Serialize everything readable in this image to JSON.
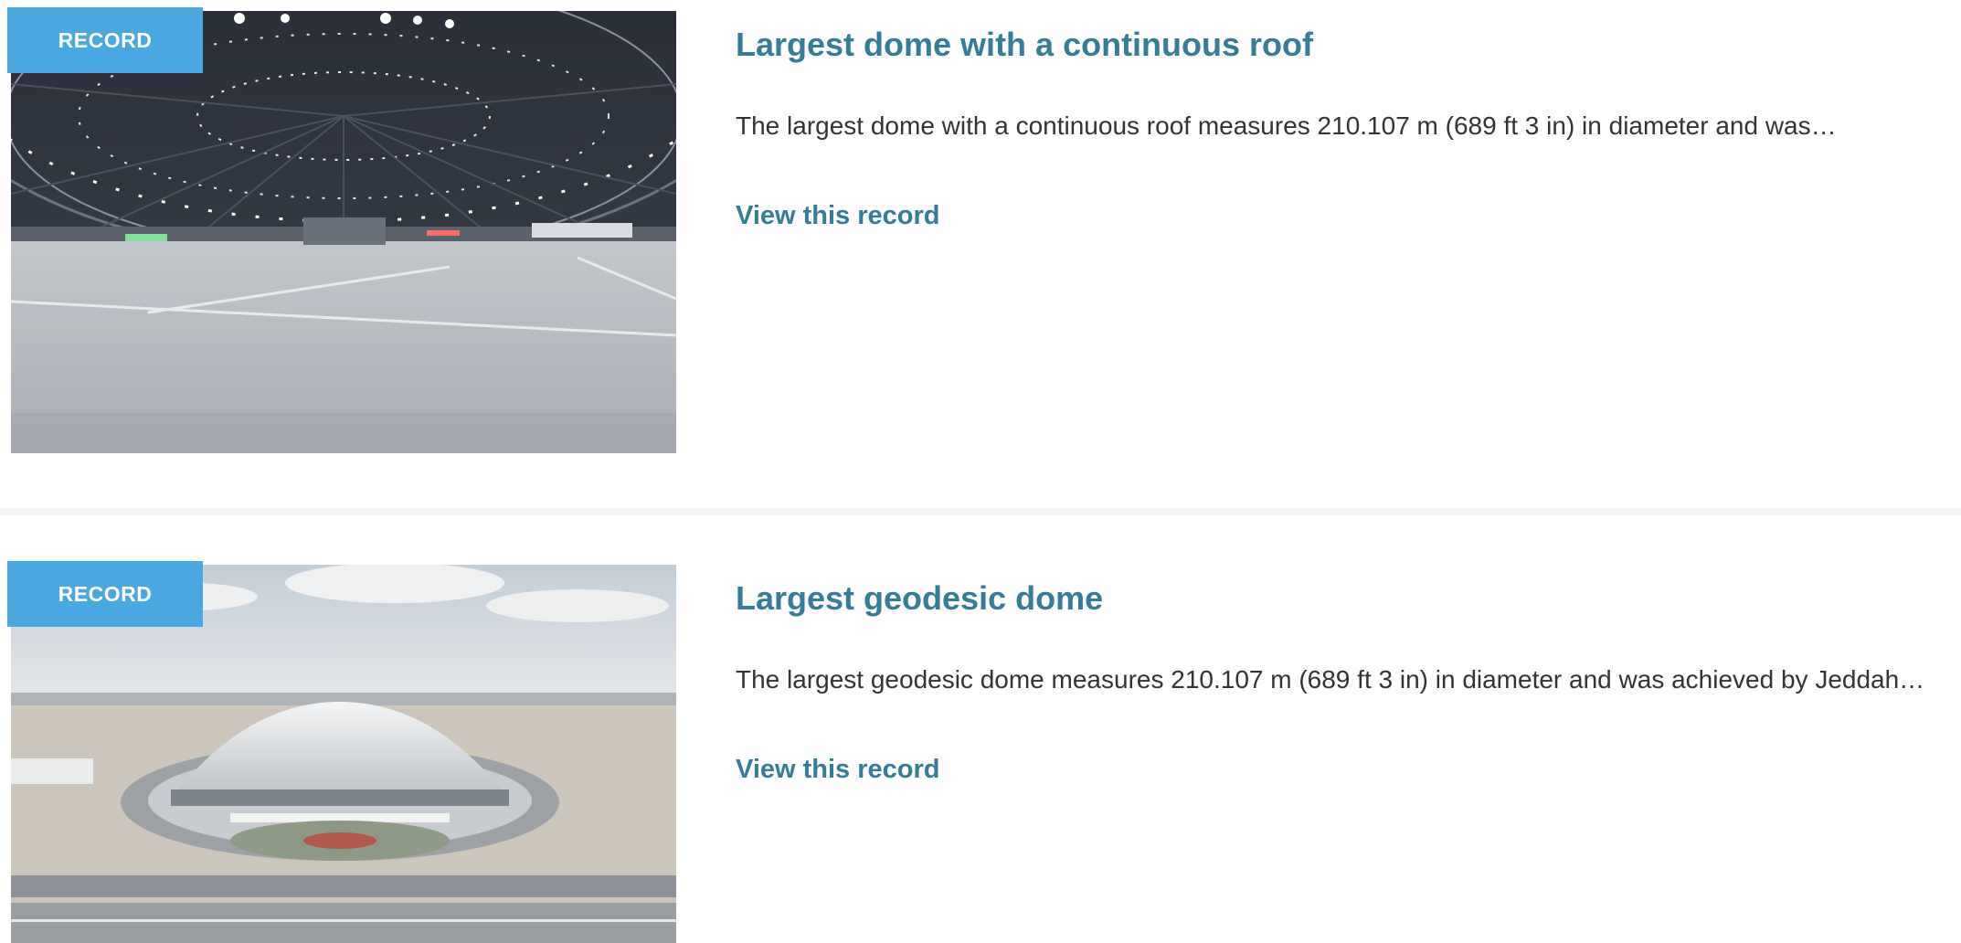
{
  "records": [
    {
      "badge": "RECORD",
      "title": "Largest dome with a continuous roof",
      "description": "The largest dome with a continuous roof measures 210.107 m (689 ft 3 in) in diameter and was…",
      "link_label": "View this record"
    },
    {
      "badge": "RECORD",
      "title": "Largest geodesic dome",
      "description": "The largest geodesic dome measures 210.107 m (689 ft 3 in) in diameter and was achieved by Jeddah…",
      "link_label": "View this record"
    }
  ],
  "colors": {
    "badge_bg": "#4aa8e0",
    "title": "#357c96",
    "body_text": "#333333",
    "divider": "#f3f3f3"
  }
}
